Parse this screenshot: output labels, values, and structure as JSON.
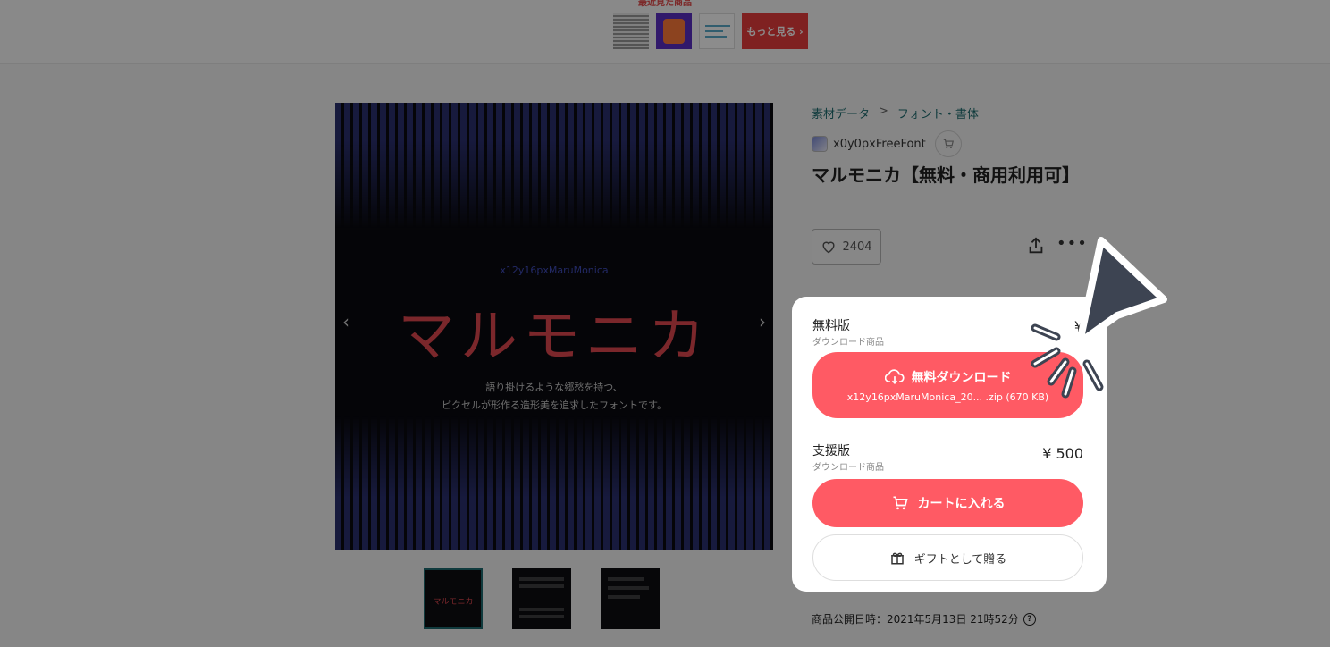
{
  "top_strip": {
    "label": "最近見た商品",
    "more_button": "もっと見る ›"
  },
  "main_image": {
    "subtitle": "x12y16pxMaruMonica",
    "title": "マルモニカ",
    "desc_line1": "語り掛けるような郷愁を持つ、",
    "desc_line2": "ピクセルが形作る造形美を追求したフォントです。"
  },
  "thumbnails": [
    {
      "label": "マルモニカ"
    },
    {
      "label": ""
    },
    {
      "label": ""
    }
  ],
  "breadcrumb": {
    "category": "素材データ",
    "separator": ">",
    "subcategory": "フォント・書体"
  },
  "seller": {
    "name": "x0y0pxFreeFont"
  },
  "product": {
    "title": "マルモニカ【無料・商用利用可】",
    "likes": "2404"
  },
  "plans": {
    "free": {
      "name": "無料版",
      "type": "ダウンロード商品",
      "price": "¥",
      "button_label": "無料ダウンロード",
      "file": "x12y16pxMaruMonica_20... .zip (670 KB)"
    },
    "support": {
      "name": "支援版",
      "type": "ダウンロード商品",
      "price": "¥ 500",
      "cart_label": "カートに入れる",
      "gift_label": "ギフトとして贈る"
    }
  },
  "published": "商品公開日時：2021年5月13日 21時52分",
  "colors": {
    "accent": "#ff5a64",
    "link": "#1b6b6e",
    "cursor": "#3d4452"
  },
  "icons": [
    "cloud-download-icon",
    "cart-icon",
    "gift-icon",
    "heart-icon",
    "share-icon",
    "more-icon",
    "help-icon",
    "cursor-pointer-icon"
  ]
}
